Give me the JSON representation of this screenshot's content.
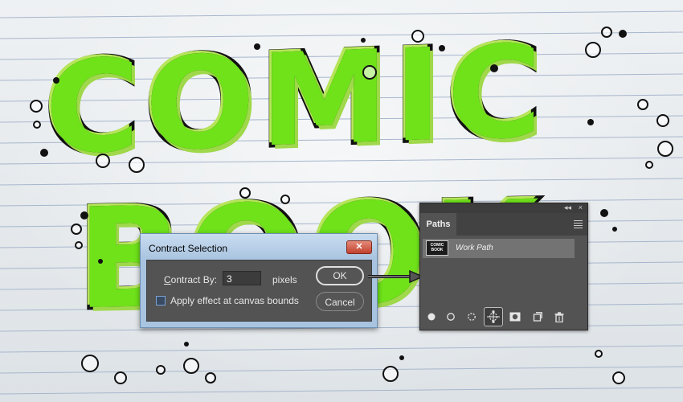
{
  "artwork": {
    "line1": "COMIC",
    "line2": "BOOK",
    "fill_color": "#6fe21a",
    "outline_color": "#111111"
  },
  "dialog": {
    "title": "Contract Selection",
    "contract_label_underlined": "C",
    "contract_label_rest": "ontract By:",
    "contract_value": "3",
    "units": "pixels",
    "apply_label": "Apply effect at canvas bounds",
    "apply_checked": false,
    "ok_label": "OK",
    "cancel_label": "Cancel",
    "close_glyph": "✕"
  },
  "panel": {
    "tab_label": "Paths",
    "collapse_glyph": "◂◂",
    "close_glyph": "×",
    "paths": [
      {
        "name": "Work Path",
        "thumb_text": "COMIC BOOK"
      }
    ],
    "tools": [
      "fill-path-icon",
      "stroke-path-icon",
      "load-as-selection-icon",
      "make-work-path-icon",
      "add-mask-icon",
      "new-path-icon",
      "delete-path-icon"
    ],
    "active_tool": "make-work-path-icon"
  }
}
